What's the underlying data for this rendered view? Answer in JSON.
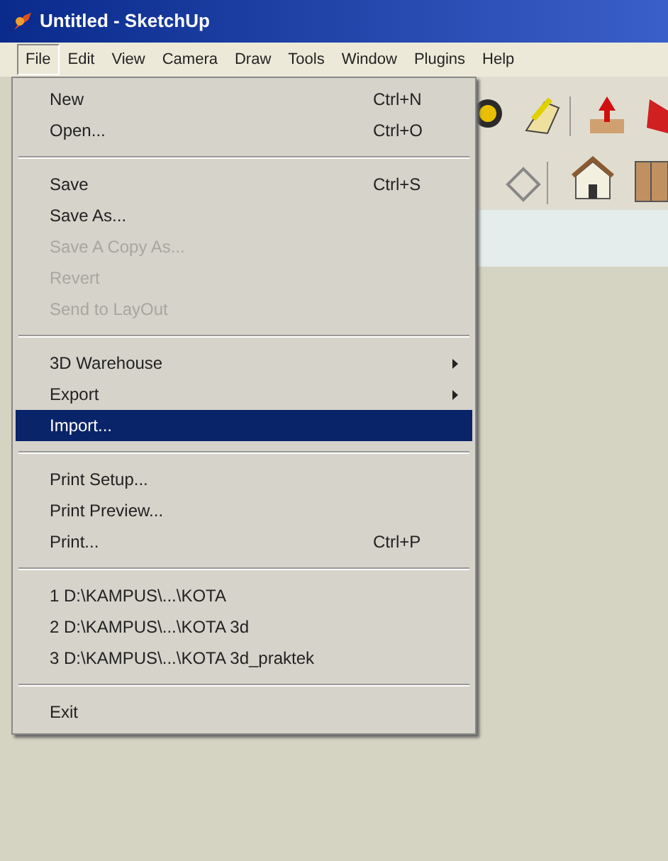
{
  "window": {
    "title": "Untitled - SketchUp"
  },
  "menu_bar": [
    {
      "label": "File",
      "selected": true
    },
    {
      "label": "Edit",
      "selected": false
    },
    {
      "label": "View",
      "selected": false
    },
    {
      "label": "Camera",
      "selected": false
    },
    {
      "label": "Draw",
      "selected": false
    },
    {
      "label": "Tools",
      "selected": false
    },
    {
      "label": "Window",
      "selected": false
    },
    {
      "label": "Plugins",
      "selected": false
    },
    {
      "label": "Help",
      "selected": false
    }
  ],
  "file_menu": [
    {
      "kind": "item",
      "label": "New",
      "shortcut": "Ctrl+N",
      "disabled": false,
      "selected": false,
      "submenu": false
    },
    {
      "kind": "item",
      "label": "Open...",
      "shortcut": "Ctrl+O",
      "disabled": false,
      "selected": false,
      "submenu": false
    },
    {
      "kind": "separator"
    },
    {
      "kind": "item",
      "label": "Save",
      "shortcut": "Ctrl+S",
      "disabled": false,
      "selected": false,
      "submenu": false
    },
    {
      "kind": "item",
      "label": "Save As...",
      "disabled": false,
      "selected": false,
      "submenu": false
    },
    {
      "kind": "item",
      "label": "Save A Copy As...",
      "disabled": true,
      "selected": false,
      "submenu": false
    },
    {
      "kind": "item",
      "label": "Revert",
      "disabled": true,
      "selected": false,
      "submenu": false
    },
    {
      "kind": "item",
      "label": "Send to LayOut",
      "disabled": true,
      "selected": false,
      "submenu": false
    },
    {
      "kind": "separator"
    },
    {
      "kind": "item",
      "label": "3D Warehouse",
      "disabled": false,
      "selected": false,
      "submenu": true
    },
    {
      "kind": "item",
      "label": "Export",
      "disabled": false,
      "selected": false,
      "submenu": true
    },
    {
      "kind": "item",
      "label": "Import...",
      "disabled": false,
      "selected": true,
      "submenu": false
    },
    {
      "kind": "separator"
    },
    {
      "kind": "item",
      "label": "Print Setup...",
      "disabled": false,
      "selected": false,
      "submenu": false
    },
    {
      "kind": "item",
      "label": "Print Preview...",
      "disabled": false,
      "selected": false,
      "submenu": false
    },
    {
      "kind": "item",
      "label": "Print...",
      "shortcut": "Ctrl+P",
      "disabled": false,
      "selected": false,
      "submenu": false
    },
    {
      "kind": "separator"
    },
    {
      "kind": "item",
      "label": "1 D:\\KAMPUS\\...\\KOTA",
      "disabled": false,
      "selected": false,
      "submenu": false
    },
    {
      "kind": "item",
      "label": "2 D:\\KAMPUS\\...\\KOTA 3d",
      "disabled": false,
      "selected": false,
      "submenu": false
    },
    {
      "kind": "item",
      "label": "3 D:\\KAMPUS\\...\\KOTA 3d_praktek",
      "disabled": false,
      "selected": false,
      "submenu": false
    },
    {
      "kind": "separator"
    },
    {
      "kind": "item",
      "label": "Exit",
      "disabled": false,
      "selected": false,
      "submenu": false
    }
  ]
}
